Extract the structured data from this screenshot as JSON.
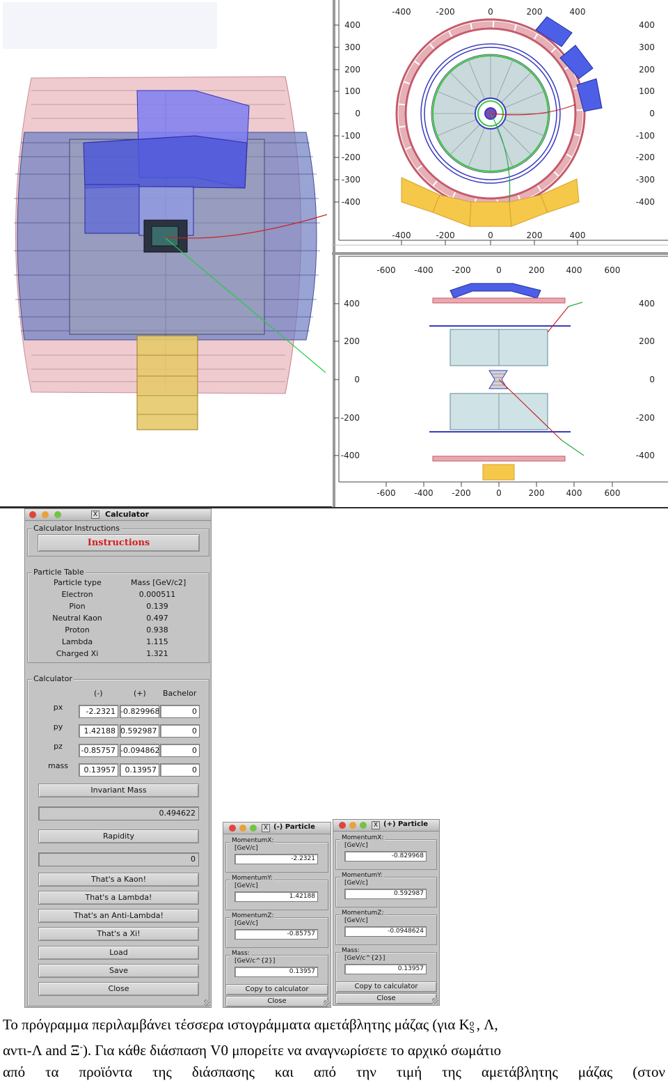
{
  "event_display": {
    "xy_axis_ticks": {
      "x": [
        "-400",
        "-200",
        "0",
        "200",
        "400"
      ],
      "y": [
        "400",
        "300",
        "200",
        "100",
        "0",
        "-100",
        "-200",
        "-300",
        "-400"
      ]
    },
    "rz_axis_ticks": {
      "x": [
        "-600",
        "-400",
        "-200",
        "0",
        "200",
        "400",
        "600"
      ],
      "y": [
        "400",
        "200",
        "0",
        "-200",
        "-400"
      ]
    }
  },
  "calculator": {
    "title": "Calculator",
    "instructions_group": "Calculator Instructions",
    "instructions_button": "Instructions",
    "particle_table": {
      "group": "Particle Table",
      "headers": [
        "Particle type",
        "Mass [GeV/c2]"
      ],
      "rows": [
        {
          "name": "Electron",
          "mass": "0.000511"
        },
        {
          "name": "Pion",
          "mass": "0.139"
        },
        {
          "name": "Neutral Kaon",
          "mass": "0.497"
        },
        {
          "name": "Proton",
          "mass": "0.938"
        },
        {
          "name": "Lambda",
          "mass": "1.115"
        },
        {
          "name": "Charged Xi",
          "mass": "1.321"
        }
      ]
    },
    "calc": {
      "group": "Calculator",
      "col_headers": [
        "(-)",
        "(+)",
        "Bachelor"
      ],
      "rows": [
        {
          "label": "px",
          "neg": "-2.2321",
          "pos": "-0.829968",
          "bach": "0"
        },
        {
          "label": "py",
          "neg": "1.42188",
          "pos": "0.592987",
          "bach": "0"
        },
        {
          "label": "pz",
          "neg": "-0.85757",
          "pos": "-0.0948624",
          "bach": "0"
        },
        {
          "label": "mass",
          "neg": "0.13957",
          "pos": "0.13957",
          "bach": "0"
        }
      ],
      "invariant_mass_button": "Invariant Mass",
      "invariant_mass_value": "0.494622",
      "rapidity_button": "Rapidity",
      "rapidity_value": "0",
      "kaon_button": "That's a Kaon!",
      "lambda_button": "That's a Lambda!",
      "antilambda_button": "That's an Anti-Lambda!",
      "xi_button": "That's a Xi!",
      "load_button": "Load",
      "save_button": "Save",
      "close_button": "Close"
    }
  },
  "neg_particle": {
    "title": "(-) Particle",
    "fields": [
      {
        "label": "MomentumX:",
        "unit": "[GeV/c]",
        "value": "-2.2321"
      },
      {
        "label": "MomentumY:",
        "unit": "[GeV/c]",
        "value": "1.42188"
      },
      {
        "label": "MomentumZ:",
        "unit": "[GeV/c]",
        "value": "-0.85757"
      },
      {
        "label": "Mass:",
        "unit": "[GeV/c^{2}]",
        "value": "0.13957"
      }
    ],
    "copy_button": "Copy to calculator",
    "close_button": "Close"
  },
  "pos_particle": {
    "title": "(+) Particle",
    "fields": [
      {
        "label": "MomentumX:",
        "unit": "[GeV/c]",
        "value": "-0.829968"
      },
      {
        "label": "MomentumY:",
        "unit": "[GeV/c]",
        "value": "0.592987"
      },
      {
        "label": "MomentumZ:",
        "unit": "[GeV/c]",
        "value": "-0.0948624"
      },
      {
        "label": "Mass:",
        "unit": "[GeV/c^{2}]",
        "value": "0.13957"
      }
    ],
    "copy_button": "Copy to calculator",
    "close_button": "Close"
  },
  "caption": {
    "line1_a": "Το πρόγραμμα περιλαμβάνει τέσσερα ιστογράμματα αμετάβλητης μάζας (για K",
    "line1_sup": "o",
    "line1_sub": "S",
    "line1_b": ", Λ,",
    "line2_a": "αντι-Λ and Ξ",
    "line2_sup": "-",
    "line2_b": ").  Για κάθε διάσπαση V0 μπορείτε να αναγνωρίσετε το αρχικό σωμάτιο",
    "line3": "από τα προϊόντα της διάσπασης και από την τιμή της αμετάβλητης μάζας (στον"
  }
}
